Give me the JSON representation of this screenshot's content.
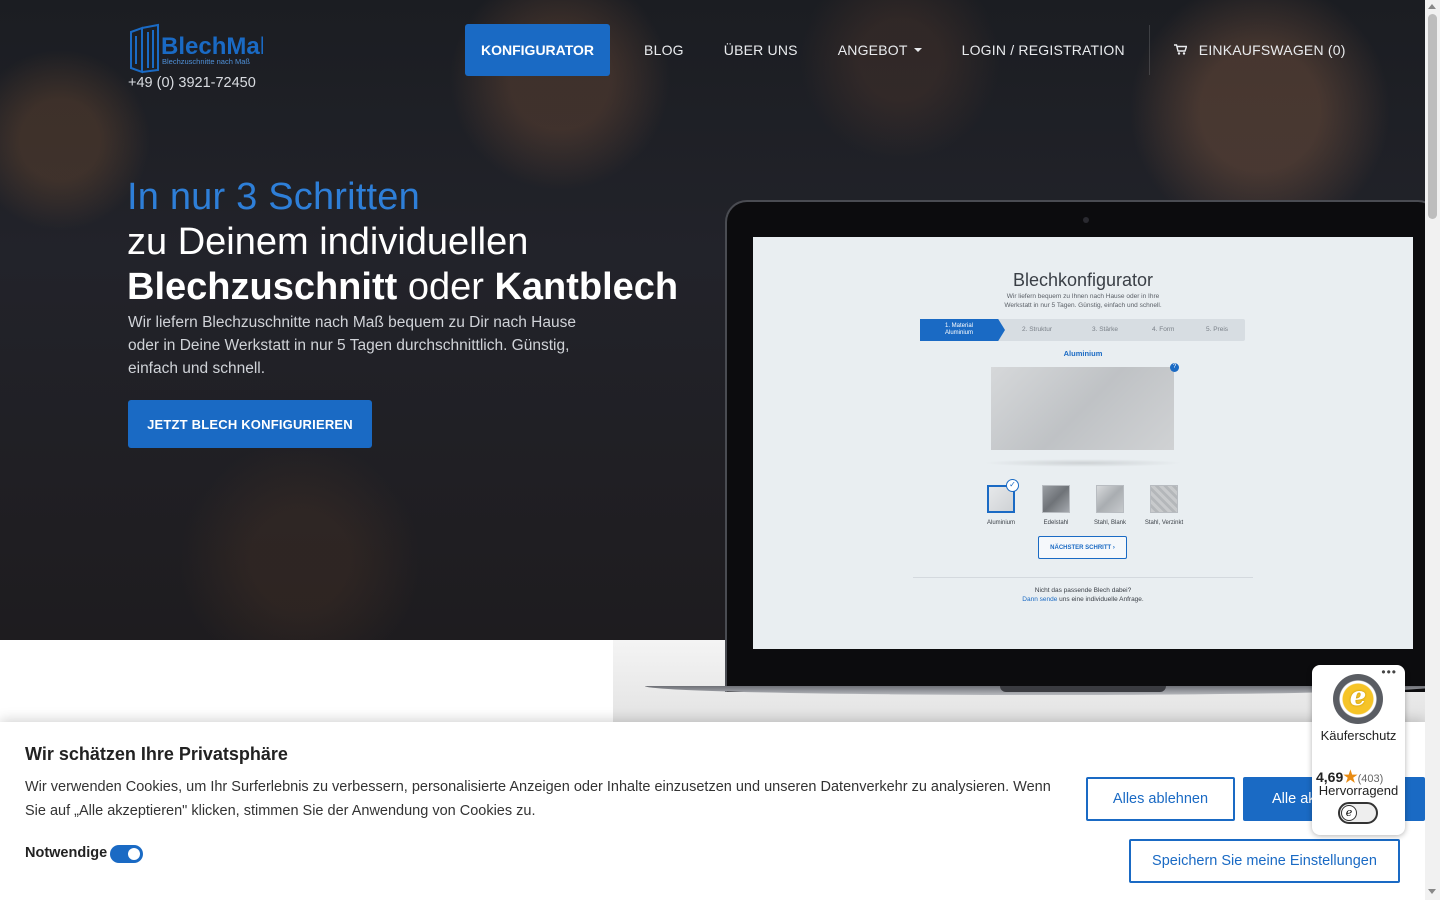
{
  "header": {
    "logo_text": "BlechMal",
    "logo_tagline": "Blechzuschnitte nach Maß",
    "phone": "+49 (0) 3921-72450",
    "nav": {
      "configurator": "KONFIGURATOR",
      "blog": "BLOG",
      "about": "ÜBER UNS",
      "offer": "ANGEBOT",
      "login": "LOGIN / REGISTRATION",
      "cart": "EINKAUFSWAGEN (0)"
    }
  },
  "hero": {
    "line1": "In nur 3 Schritten",
    "line2": "zu Deinem individuellen",
    "line3_bold1": "Blechzuschnitt",
    "line3_mid": "oder",
    "line3_bold2": "Kantblech",
    "subtitle": "Wir liefern Blechzuschnitte nach Maß bequem zu Dir nach Hause oder in Deine Werkstatt in nur 5 Tagen durchschnittlich. Günstig, einfach und schnell.",
    "cta": "JETZT BLECH KONFIGURIEREN"
  },
  "laptop_screen": {
    "title": "Blechkonfigurator",
    "subtitle": "Wir liefern bequem zu Ihnen nach Hause oder in Ihre Werkstatt in nur 5 Tagen. Günstig, einfach und schnell.",
    "steps": [
      "1. Material",
      "Aluminium",
      "2. Struktur",
      "3. Stärke",
      "4. Form",
      "5. Preis"
    ],
    "selected_material": "Aluminium",
    "help": "?",
    "materials": [
      "Aluminium",
      "Edelstahl",
      "Stahl, Blank",
      "Stahl, Verzinkt"
    ],
    "next_button": "NÄCHSTER SCHRITT ›",
    "footer_q": "Nicht das passende Blech dabei?",
    "footer_link": "Dann sende",
    "footer_rest": "uns eine individuelle Anfrage."
  },
  "cookie": {
    "title": "Wir schätzen Ihre Privatsphäre",
    "text": "Wir verwenden Cookies, um Ihr Surferlebnis zu verbessern, personalisierte Anzeigen oder Inhalte einzusetzen und unseren Datenverkehr zu analysieren. Wenn Sie auf „Alle akzeptieren\" klicken, stimmen Sie der Anwendung von Cookies zu.",
    "toggle_label": "Notwendige",
    "reject": "Alles ablehnen",
    "accept": "Alle akzeptieren",
    "save": "Speichern Sie meine Einstellungen"
  },
  "trusted_shops": {
    "dots": "•••",
    "seal_letter": "e",
    "label": "Käuferschutz",
    "rating": "4,69",
    "star": "★",
    "count": "(403)",
    "verdict": "Hervorragend",
    "toggle_letter": "e"
  },
  "colors": {
    "accent": "#1a6ac4",
    "hero_blue_text": "#2e7fd8"
  }
}
